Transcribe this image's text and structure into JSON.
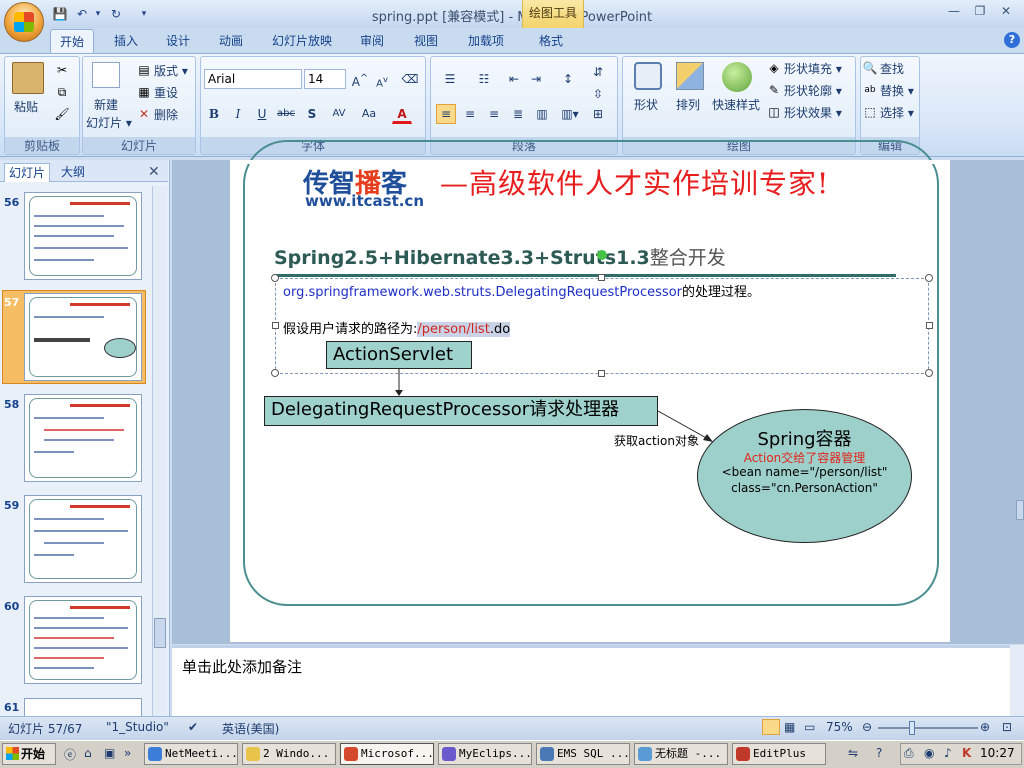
{
  "window": {
    "title": "spring.ppt [兼容模式] - Microsoft PowerPoint",
    "context_tab_group": "绘图工具"
  },
  "ribbon_tabs": [
    "开始",
    "插入",
    "设计",
    "动画",
    "幻灯片放映",
    "审阅",
    "视图",
    "加载项",
    "格式"
  ],
  "ribbon": {
    "clipboard": {
      "paste": "粘贴",
      "label": "剪贴板"
    },
    "slides": {
      "new_slide": "新建",
      "new_slide_2": "幻灯片 ▾",
      "layout": "版式 ▾",
      "reset": "重设",
      "delete": "删除",
      "label": "幻灯片"
    },
    "font": {
      "font_name": "Arial",
      "font_size": "14",
      "label": "字体"
    },
    "paragraph": {
      "label": "段落"
    },
    "drawing": {
      "shapes": "形状",
      "arrange": "排列",
      "quick_styles": "快速样式",
      "fill": "形状填充 ▾",
      "outline": "形状轮廓 ▾",
      "effects": "形状效果 ▾",
      "label": "绘图"
    },
    "editing": {
      "find": "查找",
      "replace": "替换 ▾",
      "select": "选择 ▾",
      "label": "编辑"
    }
  },
  "left_pane": {
    "tabs": [
      "幻灯片",
      "大纲"
    ],
    "thumb_numbers": [
      "56",
      "57",
      "58",
      "59",
      "60",
      "61"
    ]
  },
  "slide": {
    "logo_part1": "传智",
    "logo_part2": "播",
    "logo_part3": "客",
    "logo_url": "www.itcast.cn",
    "slogan": "—高级软件人才实作培训专家!",
    "heading_en": "Spring2.5+Hibernate3.3+Struts1.3",
    "heading_cn": "整合开发",
    "line1_en": "org.springframework.web.struts.DelegatingRequestProcessor",
    "line1_cn": "的处理过程。",
    "line2_prefix": "假设用户请求的路径为:",
    "line2_path": "/person/list",
    "line2_ext": ".do",
    "box1": "ActionServlet",
    "box2": "DelegatingRequestProcessor请求处理器",
    "arrow_label": "获取action对象",
    "ellipse_title": "Spring容器",
    "ellipse_red": "Action交给了容器管理",
    "ellipse_line1": "<bean name=\"/person/list\"",
    "ellipse_line2": "class=\"cn.PersonAction\""
  },
  "notes": {
    "placeholder": "单击此处添加备注"
  },
  "status": {
    "slide_count": "幻灯片 57/67",
    "theme": "\"1_Studio\"",
    "language": "英语(美国)",
    "zoom": "75%"
  },
  "taskbar": {
    "start": "开始",
    "tasks": [
      "NetMeeti...",
      "2 Windo...",
      "Microsof...",
      "MyEclips...",
      "EMS SQL ...",
      "无标题 -...",
      "EditPlus"
    ],
    "clock": "10:27"
  },
  "colors": {
    "accent": "#15428b",
    "slogan_red": "#e81d1d",
    "shape_fill": "#9fd1cd",
    "selected_thumb": "#f6bd64"
  }
}
